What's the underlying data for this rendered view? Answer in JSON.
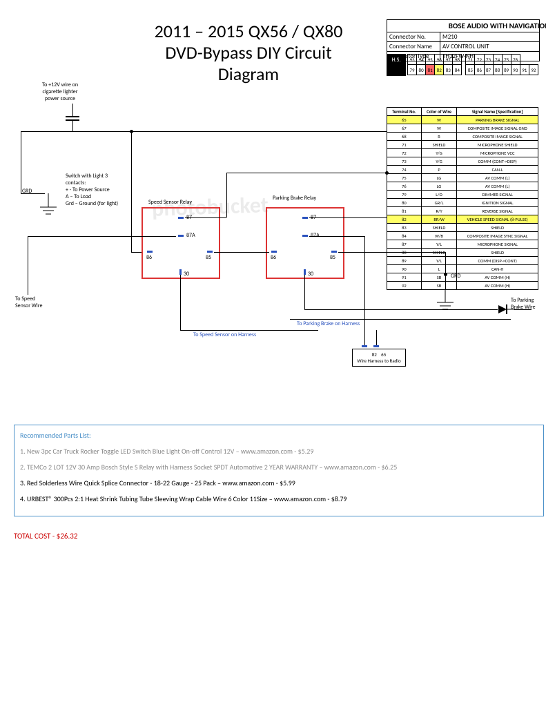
{
  "title": "2011 – 2015 QX56 / QX80 DVD-Bypass DIY Circuit Diagram",
  "power_label": "To +12V wire on cigarette lighter power source",
  "switch_label": "Switch with Light 3 contacts:\n+ - To Power Source\nA – To Load\nGrd – Ground (for light)",
  "grd": "GRD",
  "relay1_label": "Speed Sensor Relay",
  "relay2_label": "Parking Brake Relay",
  "relay_pins": {
    "p87": "87",
    "p87a": "87A",
    "p86": "86",
    "p85": "85",
    "p30": "30"
  },
  "to_speed": "To Speed Sensor Wire",
  "to_pbrake": "To Parking Brake Wire",
  "to_pb_harness": "To Parking Brake on Harness",
  "to_ss_harness": "To Speed Sensor on Harness",
  "harness_pins": {
    "a": "82",
    "b": "65"
  },
  "harness_caption": "Wire Harness to Radio",
  "connector": {
    "heading": "BOSE AUDIO WITH NAVIGATION",
    "no_lbl": "Connector No.",
    "no_val": "M210",
    "name_lbl": "Connector Name",
    "name_val": "AV CONTROL UNIT",
    "type_lbl": "Connector Type",
    "type_val": "TH32FW-NH",
    "hs": "H.S."
  },
  "pin_rows": [
    [
      "93",
      "94",
      "95",
      "96",
      "97",
      "98",
      "",
      "71",
      "72",
      "73",
      "74",
      "75",
      "76"
    ],
    [
      "79",
      "80",
      "81",
      "82",
      "83",
      "84",
      "",
      "85",
      "86",
      "87",
      "88",
      "89",
      "90",
      "91",
      "92"
    ]
  ],
  "pin_hl": {
    "65": "hl",
    "82": "hl",
    "81": "hlr"
  },
  "signals": [
    {
      "no": "65",
      "col": "W",
      "name": "PARKING BRAKE SIGNAL",
      "hl": true
    },
    {
      "no": "67",
      "col": "W",
      "name": "COMPOSITE IMAGE SIGNAL GND"
    },
    {
      "no": "68",
      "col": "R",
      "name": "COMPOSITE IMAGE SIGNAL"
    },
    {
      "no": "71",
      "col": "SHIELD",
      "name": "MICROPHONE SHIELD"
    },
    {
      "no": "72",
      "col": "Y/G",
      "name": "MICROPHONE VCC"
    },
    {
      "no": "73",
      "col": "Y/G",
      "name": "COMM (CONT->DISP)"
    },
    {
      "no": "74",
      "col": "P",
      "name": "CAN-L"
    },
    {
      "no": "75",
      "col": "LG",
      "name": "AV COMM (L)"
    },
    {
      "no": "76",
      "col": "LG",
      "name": "AV COMM (L)"
    },
    {
      "no": "79",
      "col": "L/O",
      "name": "DIMMER SIGNAL"
    },
    {
      "no": "80",
      "col": "GR/L",
      "name": "IGNITION SIGNAL"
    },
    {
      "no": "81",
      "col": "R/Y",
      "name": "REVERSE SIGNAL"
    },
    {
      "no": "82",
      "col": "BR/W",
      "name": "VEHICLE SPEED SIGNAL (8-PULSE)",
      "hl": true
    },
    {
      "no": "83",
      "col": "SHIELD",
      "name": "SHIELD"
    },
    {
      "no": "84",
      "col": "W/B",
      "name": "COMPOSITE IMAGE SYNC SIGNAL"
    },
    {
      "no": "87",
      "col": "Y/L",
      "name": "MICROPHONE SIGNAL"
    },
    {
      "no": "88",
      "col": "SHIELD",
      "name": "SHIELD"
    },
    {
      "no": "89",
      "col": "Y/L",
      "name": "COMM (DISP->CONT)"
    },
    {
      "no": "90",
      "col": "L",
      "name": "CAN-H"
    },
    {
      "no": "91",
      "col": "SB",
      "name": "AV COMM (H)"
    },
    {
      "no": "92",
      "col": "SB",
      "name": "AV COMM (H)"
    }
  ],
  "sig_headers": {
    "no": "Terminal No.",
    "col": "Color of Wire",
    "name": "Signal Name [Specification]"
  },
  "parts": {
    "hdr": "Recommended Parts List:",
    "items": [
      {
        "txt": "1. New 3pc Car Truck Rocker Toggle LED Switch Blue Light On-off Control 12V – www.amazon.com - $5.29",
        "grey": true
      },
      {
        "txt": "2. TEMCo 2 LOT 12V 30 Amp Bosch Style S Relay with Harness Socket SPDT Automotive 2 YEAR WARRANTY – www.amazon.com - $6.25",
        "grey": true
      },
      {
        "txt": "3. Red Solderless Wire Quick Splice Connector - 18-22 Gauge - 25 Pack – www.amazon.com - $5.99",
        "grey": false
      },
      {
        "txt": "4. URBEST® 300Pcs 2:1 Heat Shrink Tubing Tube Sleeving Wrap Cable Wire 6 Color 11Size – www.amazon.com - $8.79",
        "grey": false
      }
    ]
  },
  "total": "TOTAL COST - $26.32"
}
